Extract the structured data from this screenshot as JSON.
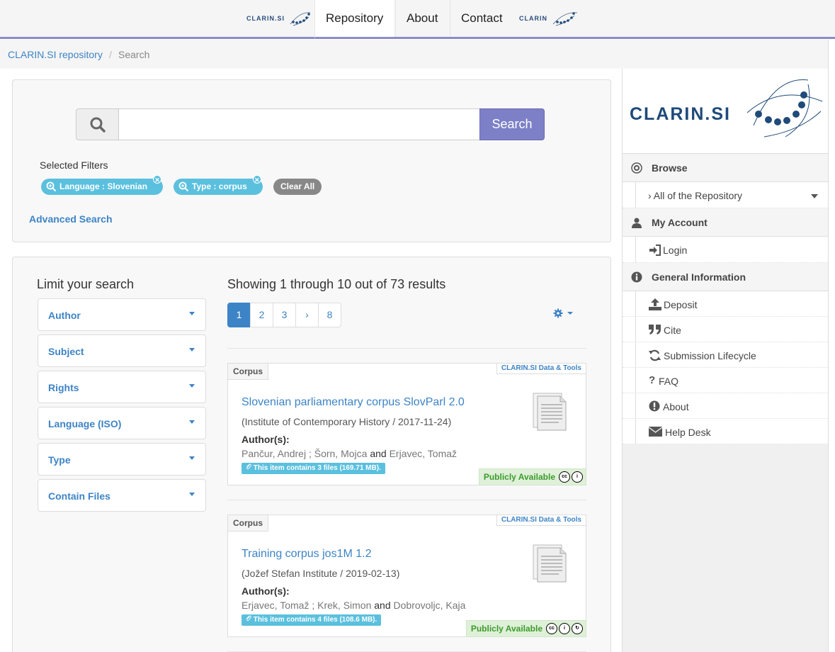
{
  "nav": {
    "logo_left_text": "CLARIN.SI",
    "tabs": [
      "Repository",
      "About",
      "Contact"
    ],
    "logo_right_text": "CLARIN"
  },
  "breadcrumb": {
    "home": "CLARIN.SI repository",
    "separator": "/",
    "current": "Search"
  },
  "search": {
    "button_label": "Search",
    "query": "",
    "selected_filters_label": "Selected Filters",
    "filters": [
      "Language : Slovenian",
      "Type : corpus"
    ],
    "clear_all": "Clear All",
    "advanced_label": "Advanced Search"
  },
  "facets": {
    "title": "Limit your search",
    "items": [
      "Author",
      "Subject",
      "Rights",
      "Language (ISO)",
      "Type",
      "Contain Files"
    ]
  },
  "results": {
    "summary": "Showing 1 through 10 out of 73 results",
    "pages": [
      "1",
      "2",
      "3",
      "›",
      "8"
    ],
    "items": [
      {
        "type": "Corpus",
        "branding": "CLARIN.SI Data & Tools",
        "title": "Slovenian parliamentary corpus SlovParl 2.0",
        "publisher": "Institute of Contemporary History",
        "date": "2017-11-24",
        "authors_label": "Author(s):",
        "authors": [
          "Pančur, Andrej",
          "Šorn, Mojca",
          "Erjavec, Tomaž"
        ],
        "files": "This item contains 3 files (169.71 MB).",
        "availability": "Publicly Available",
        "licenses": [
          "cc",
          "by"
        ]
      },
      {
        "type": "Corpus",
        "branding": "CLARIN.SI Data & Tools",
        "title": "Training corpus jos1M 1.2",
        "publisher": "Jožef Stefan Institute",
        "date": "2019-02-13",
        "authors_label": "Author(s):",
        "authors": [
          "Erjavec, Tomaž",
          "Krek, Simon",
          "Dobrovoljc, Kaja"
        ],
        "files": "This item contains 4 files (108.6 MB).",
        "availability": "Publicly Available",
        "licenses": [
          "cc",
          "by",
          "sa"
        ]
      }
    ]
  },
  "sidebar": {
    "logo_text": "CLARIN.SI",
    "browse": {
      "heading": "Browse",
      "items": [
        "› All of the Repository"
      ]
    },
    "account": {
      "heading": "My Account",
      "items": [
        "Login"
      ]
    },
    "info": {
      "heading": "General Information",
      "items": [
        "Deposit",
        "Cite",
        "Submission Lifecycle",
        "FAQ",
        "About",
        "Help Desk"
      ]
    }
  },
  "colors": {
    "accent": "#7d80c6",
    "link": "#3d84c6",
    "info": "#5bc0de",
    "success": "#3c9b2e",
    "brand_navy": "#1f4a7a"
  }
}
